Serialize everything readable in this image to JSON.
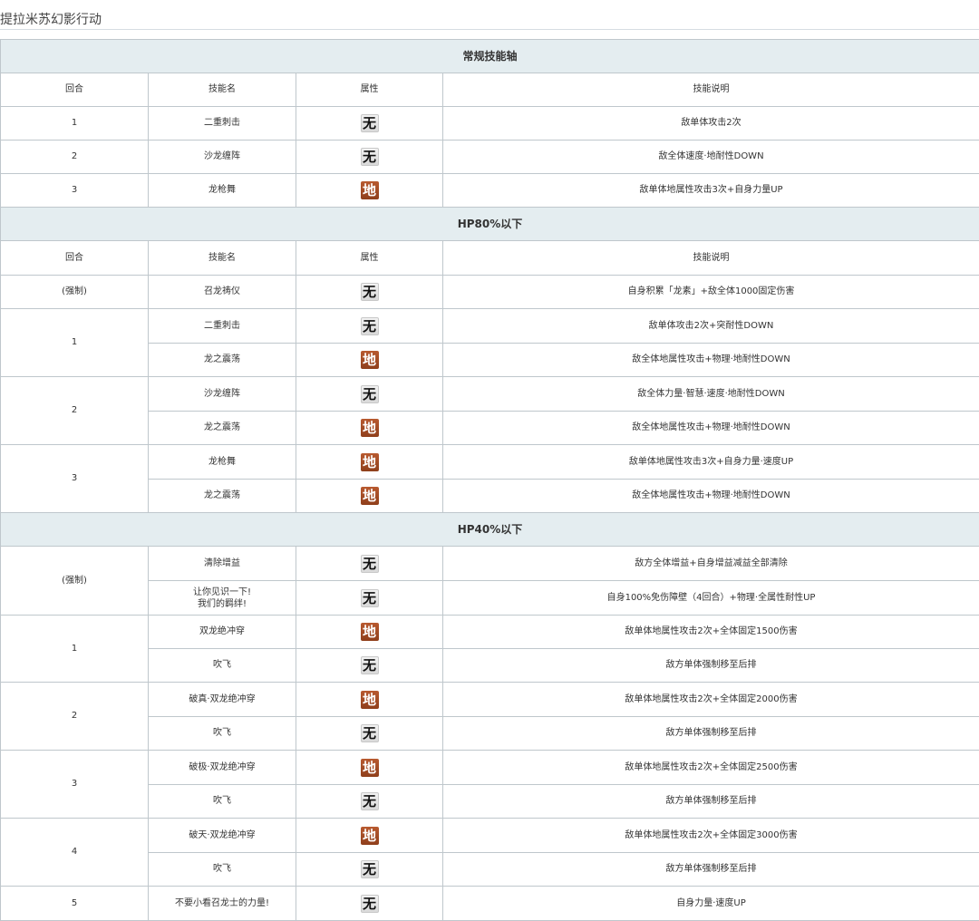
{
  "page_title": "提拉米苏幻影行动",
  "headers": {
    "round": "回合",
    "skill": "技能名",
    "attr": "属性",
    "desc": "技能说明"
  },
  "attributes": {
    "wu": "无",
    "di": "地"
  },
  "sections": {
    "s1": {
      "title": "常规技能轴",
      "rows": [
        {
          "round": "1",
          "skill": "二重刺击",
          "desc": "敌单体攻击2次"
        },
        {
          "round": "2",
          "skill": "沙龙缠阵",
          "desc": "敌全体速度·地耐性DOWN"
        },
        {
          "round": "3",
          "skill": "龙枪舞",
          "desc": "敌单体地属性攻击3次+自身力量UP"
        }
      ]
    },
    "s2": {
      "title": "HP80%以下",
      "rows": [
        {
          "round": "(强制)",
          "skill": "召龙祷仪",
          "desc": "自身积累「龙素」+敌全体1000固定伤害"
        },
        {
          "round": "1",
          "skill": "二重刺击",
          "desc": "敌单体攻击2次+突耐性DOWN"
        },
        {
          "skill": "龙之震荡",
          "desc": "敌全体地属性攻击+物理·地耐性DOWN"
        },
        {
          "round": "2",
          "skill": "沙龙缠阵",
          "desc": "敌全体力量·智慧·速度·地耐性DOWN"
        },
        {
          "skill": "龙之震荡",
          "desc": "敌全体地属性攻击+物理·地耐性DOWN"
        },
        {
          "round": "3",
          "skill": "龙枪舞",
          "desc": "敌单体地属性攻击3次+自身力量·速度UP"
        },
        {
          "skill": "龙之震荡",
          "desc": "敌全体地属性攻击+物理·地耐性DOWN"
        }
      ]
    },
    "s3": {
      "title": "HP40%以下",
      "rows": [
        {
          "round": "(强制)",
          "skill": "清除增益",
          "desc": "敌方全体增益+自身增益减益全部清除"
        },
        {
          "skill_line1": "让你见识一下!",
          "skill_line2": "我们的羁绊!",
          "desc": "自身100%免伤障壁（4回合）+物理·全属性耐性UP"
        },
        {
          "round": "1",
          "skill": "双龙绝冲穿",
          "desc": "敌单体地属性攻击2次+全体固定1500伤害"
        },
        {
          "skill": "吹飞",
          "desc": "敌方单体强制移至后排"
        },
        {
          "round": "2",
          "skill": "破真·双龙绝冲穿",
          "desc": "敌单体地属性攻击2次+全体固定2000伤害"
        },
        {
          "skill": "吹飞",
          "desc": "敌方单体强制移至后排"
        },
        {
          "round": "3",
          "skill": "破极·双龙绝冲穿",
          "desc": "敌单体地属性攻击2次+全体固定2500伤害"
        },
        {
          "skill": "吹飞",
          "desc": "敌方单体强制移至后排"
        },
        {
          "round": "4",
          "skill": "破天·双龙绝冲穿",
          "desc": "敌单体地属性攻击2次+全体固定3000伤害"
        },
        {
          "skill": "吹飞",
          "desc": "敌方单体强制移至后排"
        },
        {
          "round": "5",
          "skill": "不要小看召龙士的力量!",
          "desc": "自身力量·速度UP"
        }
      ]
    }
  },
  "colors": {
    "section_bg": "#e4edf0",
    "border": "#bfc7cc",
    "earth_badge": "#a14a24",
    "none_badge": "#e6e6e6"
  }
}
